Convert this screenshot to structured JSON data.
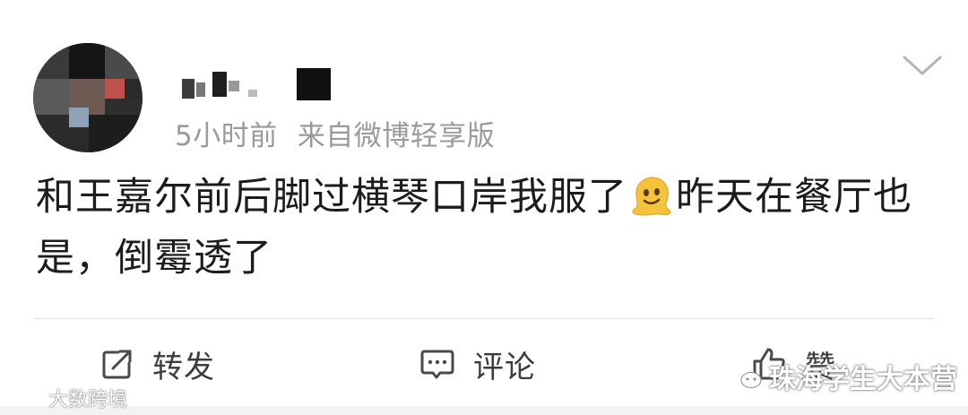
{
  "post": {
    "username": "",
    "time": "5小时前",
    "source": "来自微博轻享版",
    "text_part1": "和王嘉尔前后脚过横琴口岸我服了",
    "text_part2": "昨天在餐厅也是，倒霉透了"
  },
  "actions": {
    "repost_label": "转发",
    "comment_label": "评论",
    "like_label": "赞"
  },
  "watermarks": {
    "left": "大数跨境",
    "right": "珠海学生大本营"
  },
  "colors": {
    "text": "#1c1c1c",
    "meta": "#9a9a9a",
    "divider": "#e3e3e3",
    "emoji": "#f5c33b"
  },
  "icons": {
    "more": "chevron-down-icon",
    "repost": "repost-icon",
    "comment": "comment-icon",
    "like": "thumb-up-icon",
    "emoji": "melting-face-emoji"
  }
}
